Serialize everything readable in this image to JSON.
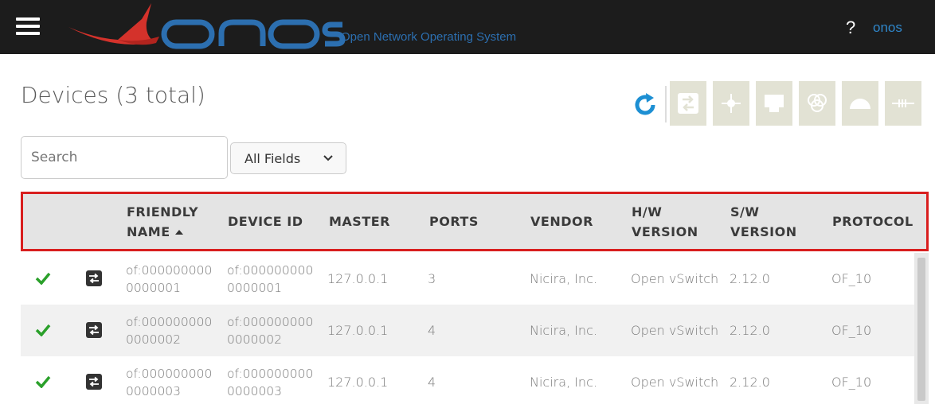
{
  "app": {
    "tagline": "Open Network Operating System",
    "help_label": "?",
    "user_label": "onos",
    "logo_text": "onos"
  },
  "page": {
    "title": "Devices (3 total)"
  },
  "search": {
    "placeholder": "Search",
    "value": ""
  },
  "filter": {
    "selected": "All Fields"
  },
  "toolbar": {
    "buttons": [
      {
        "icon": "refresh-icon",
        "enabled": true
      },
      {
        "icon": "device-details-icon",
        "enabled": false
      },
      {
        "icon": "flows-icon",
        "enabled": false
      },
      {
        "icon": "ports-icon",
        "enabled": false
      },
      {
        "icon": "groups-icon",
        "enabled": false
      },
      {
        "icon": "meters-icon",
        "enabled": false
      },
      {
        "icon": "pipeconf-icon",
        "enabled": false
      }
    ]
  },
  "table": {
    "columns": {
      "friendly_name": [
        "FRIENDLY",
        "NAME"
      ],
      "device_id": "DEVICE ID",
      "master": "MASTER",
      "ports": "PORTS",
      "vendor": "VENDOR",
      "hw_version": [
        "H/W",
        "VERSION"
      ],
      "sw_version": [
        "S/W",
        "VERSION"
      ],
      "protocol": "PROTOCOL"
    },
    "sort": {
      "column": "friendly_name",
      "direction": "ascending"
    },
    "rows": [
      {
        "status": "online",
        "friendly_name": [
          "of:000000000",
          "0000001"
        ],
        "device_id": [
          "of:000000000",
          "0000001"
        ],
        "master": "127.0.0.1",
        "ports": "3",
        "vendor": "Nicira, Inc.",
        "hw_version": "Open vSwitch",
        "sw_version": "2.12.0",
        "protocol": "OF_10"
      },
      {
        "status": "online",
        "friendly_name": [
          "of:000000000",
          "0000002"
        ],
        "device_id": [
          "of:000000000",
          "0000002"
        ],
        "master": "127.0.0.1",
        "ports": "4",
        "vendor": "Nicira, Inc.",
        "hw_version": "Open vSwitch",
        "sw_version": "2.12.0",
        "protocol": "OF_10"
      },
      {
        "status": "online",
        "friendly_name": [
          "of:000000000",
          "0000003"
        ],
        "device_id": [
          "of:000000000",
          "0000003"
        ],
        "master": "127.0.0.1",
        "ports": "4",
        "vendor": "Nicira, Inc.",
        "hw_version": "Open vSwitch",
        "sw_version": "2.12.0",
        "protocol": "OF_10"
      }
    ]
  },
  "colors": {
    "topbar": "#1c1c1c",
    "brand_blue": "#2c6fb0",
    "logo_red": "#d4322b",
    "highlight_border": "#d81e1e",
    "check_green": "#2aa02a",
    "header_bg": "#e4e4e4"
  }
}
